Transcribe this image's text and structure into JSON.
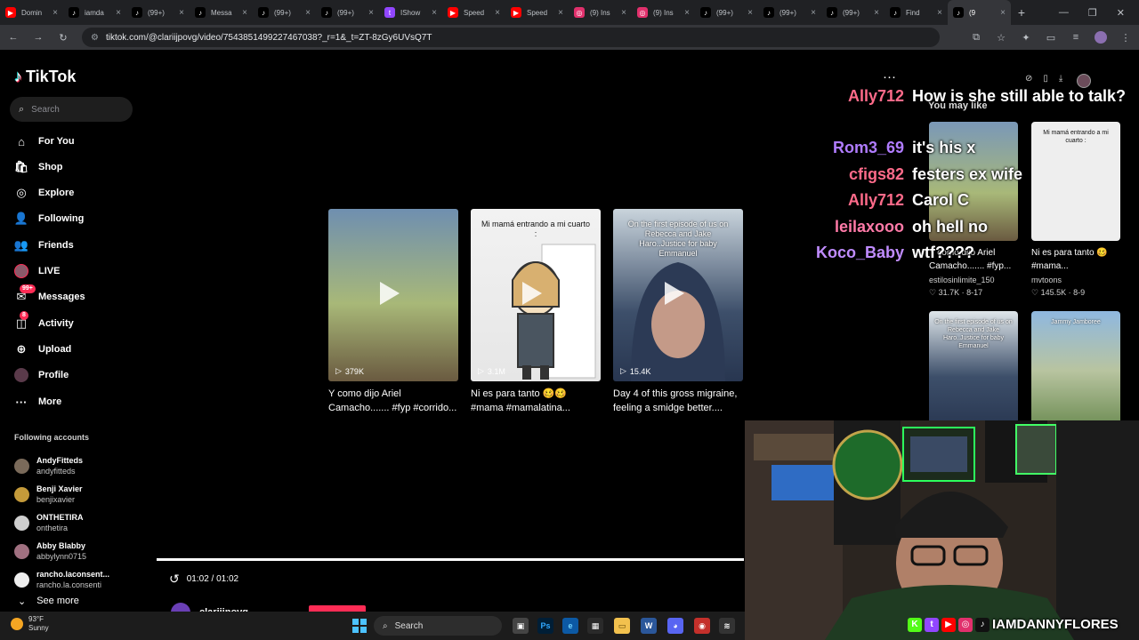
{
  "browser": {
    "tabs": [
      {
        "label": "Domin",
        "icon": "youtube-icon",
        "color": "#ff0000",
        "active": false
      },
      {
        "label": "iamda",
        "icon": "tiktok-icon",
        "color": "#000000",
        "active": false
      },
      {
        "label": "(99+)",
        "icon": "tiktok-icon",
        "color": "#000000",
        "active": false
      },
      {
        "label": "Messa",
        "icon": "tiktok-icon",
        "color": "#000000",
        "active": false
      },
      {
        "label": "(99+)",
        "icon": "tiktok-icon",
        "color": "#000000",
        "active": false
      },
      {
        "label": "(99+)",
        "icon": "tiktok-icon",
        "color": "#000000",
        "active": false
      },
      {
        "label": "IShow",
        "icon": "twitch-icon",
        "color": "#9146ff",
        "active": false
      },
      {
        "label": "Speed",
        "icon": "youtube-icon",
        "color": "#ff0000",
        "active": false
      },
      {
        "label": "Speed",
        "icon": "youtube-icon",
        "color": "#ff0000",
        "active": false
      },
      {
        "label": "(9) Ins",
        "icon": "instagram-icon",
        "color": "#e1306c",
        "active": false
      },
      {
        "label": "(9) Ins",
        "icon": "instagram-icon",
        "color": "#e1306c",
        "active": false
      },
      {
        "label": "(99+)",
        "icon": "tiktok-icon",
        "color": "#000000",
        "active": false
      },
      {
        "label": "(99+)",
        "icon": "tiktok-icon",
        "color": "#000000",
        "active": false
      },
      {
        "label": "(99+)",
        "icon": "tiktok-icon",
        "color": "#000000",
        "active": false
      },
      {
        "label": "Find",
        "icon": "tiktok-icon",
        "color": "#000000",
        "active": false
      },
      {
        "label": "(9",
        "icon": "tiktok-icon",
        "color": "#000000",
        "active": true
      }
    ],
    "url": "tiktok.com/@clariijpovg/video/7543851499227467038?_r=1&_t=ZT-8zGy6UVsQ7T"
  },
  "sidebar": {
    "logo": "TikTok",
    "search_placeholder": "Search",
    "nav": [
      {
        "label": "For You",
        "icon": "home-icon",
        "glyph": "⌂"
      },
      {
        "label": "Shop",
        "icon": "shop-bag-icon",
        "glyph": "🛍"
      },
      {
        "label": "Explore",
        "icon": "compass-icon",
        "glyph": "◎"
      },
      {
        "label": "Following",
        "icon": "user-plus-icon",
        "glyph": "👤"
      },
      {
        "label": "Friends",
        "icon": "users-icon",
        "glyph": "👥"
      },
      {
        "label": "LIVE",
        "icon": "live-avatar-icon",
        "glyph": "●"
      },
      {
        "label": "Messages",
        "icon": "message-icon",
        "glyph": "✉",
        "badge": "99+"
      },
      {
        "label": "Activity",
        "icon": "bell-icon",
        "glyph": "◫",
        "badge": "8"
      },
      {
        "label": "Upload",
        "icon": "upload-icon",
        "glyph": "⊕"
      },
      {
        "label": "Profile",
        "icon": "profile-avatar-icon",
        "glyph": "●"
      },
      {
        "label": "More",
        "icon": "more-icon",
        "glyph": "···"
      }
    ],
    "following_title": "Following accounts",
    "following": [
      {
        "name": "AndyFitteds",
        "handle": "andyfitteds",
        "mark": ""
      },
      {
        "name": "Benji Xavier",
        "handle": "benjixavier",
        "mark": "verified"
      },
      {
        "name": "ONTHETIRA",
        "handle": "onthetira",
        "mark": ""
      },
      {
        "name": "Abby Blabby",
        "handle": "abbylynn0715",
        "mark": "heart"
      },
      {
        "name": "rancho.laconsent...",
        "handle": "rancho.la.consenti",
        "mark": ""
      }
    ],
    "see_more": "See more"
  },
  "video": {
    "cards": [
      {
        "views": "379K",
        "title": "Y como dijo Ariel Camacho....... #fyp #corrido...",
        "caption": ""
      },
      {
        "views": "3.1M",
        "title": "Ni es para tanto 🥴🥴 #mama #mamalatina...",
        "caption": "Mi mamá entrando a mi cuarto :"
      },
      {
        "views": "15.4K",
        "title": "Day 4 of this gross migraine, feeling a smidge better....",
        "caption": "On the first episode of us on Rebecca and Jake Haro..Justice for baby Emmanuel"
      }
    ],
    "time": "01:02 / 01:02",
    "author": "clariijpovg"
  },
  "right_panel": {
    "you_may_like": "You may like",
    "cards": [
      {
        "title": "Y como dijo Ariel Camacho....... #fyp...",
        "author": "estilosinlimite_150",
        "likes": "31.7K",
        "date": "8-17"
      },
      {
        "title": "Ni es para tanto 🥴 #mama...",
        "author": "mvtoons",
        "likes": "145.5K",
        "date": "8-9",
        "caption": "Mi mamá entrando a mi cuarto :"
      },
      {
        "title": "",
        "author": "",
        "likes": "",
        "date": "",
        "caption": "On the first episode of us on Rebecca and Jake Haro..Justice for baby Emmanuel"
      },
      {
        "title": "",
        "author": "",
        "likes": "",
        "date": "",
        "caption": "Jammy Jamboree"
      }
    ]
  },
  "chat": [
    {
      "user": "Ally712",
      "message": "How is she still able to talk?",
      "color": "#ff6b8a"
    },
    {
      "user": "Rom3_69",
      "message": "it's his x",
      "color": "#b07cff"
    },
    {
      "user": "cfigs82",
      "message": "festers ex wife",
      "color": "#ff6b8a"
    },
    {
      "user": "Ally712",
      "message": "Carol C",
      "color": "#ff6b8a"
    },
    {
      "user": "leilaxooo",
      "message": "oh hell no",
      "color": "#ff7aa8"
    },
    {
      "user": "Koco_Baby",
      "message": "wtf????",
      "color": "#c08cff"
    }
  ],
  "stream_overlay": {
    "handle": "IAMDANNYFLORES",
    "socials": [
      {
        "icon": "kick-icon",
        "glyph": "K",
        "color": "#53fc18"
      },
      {
        "icon": "twitch-icon",
        "glyph": "t",
        "color": "#9146ff"
      },
      {
        "icon": "youtube-icon",
        "glyph": "▶",
        "color": "#ff0000"
      },
      {
        "icon": "instagram-icon",
        "glyph": "◎",
        "color": "#e1306c"
      },
      {
        "icon": "tiktok-icon",
        "glyph": "♪",
        "color": "#111111"
      }
    ]
  },
  "taskbar": {
    "temp": "93°F",
    "condition": "Sunny",
    "search": "Search"
  },
  "colors": {
    "accent": "#fe2c55",
    "cyan": "#25f4ee",
    "background": "#000000"
  }
}
